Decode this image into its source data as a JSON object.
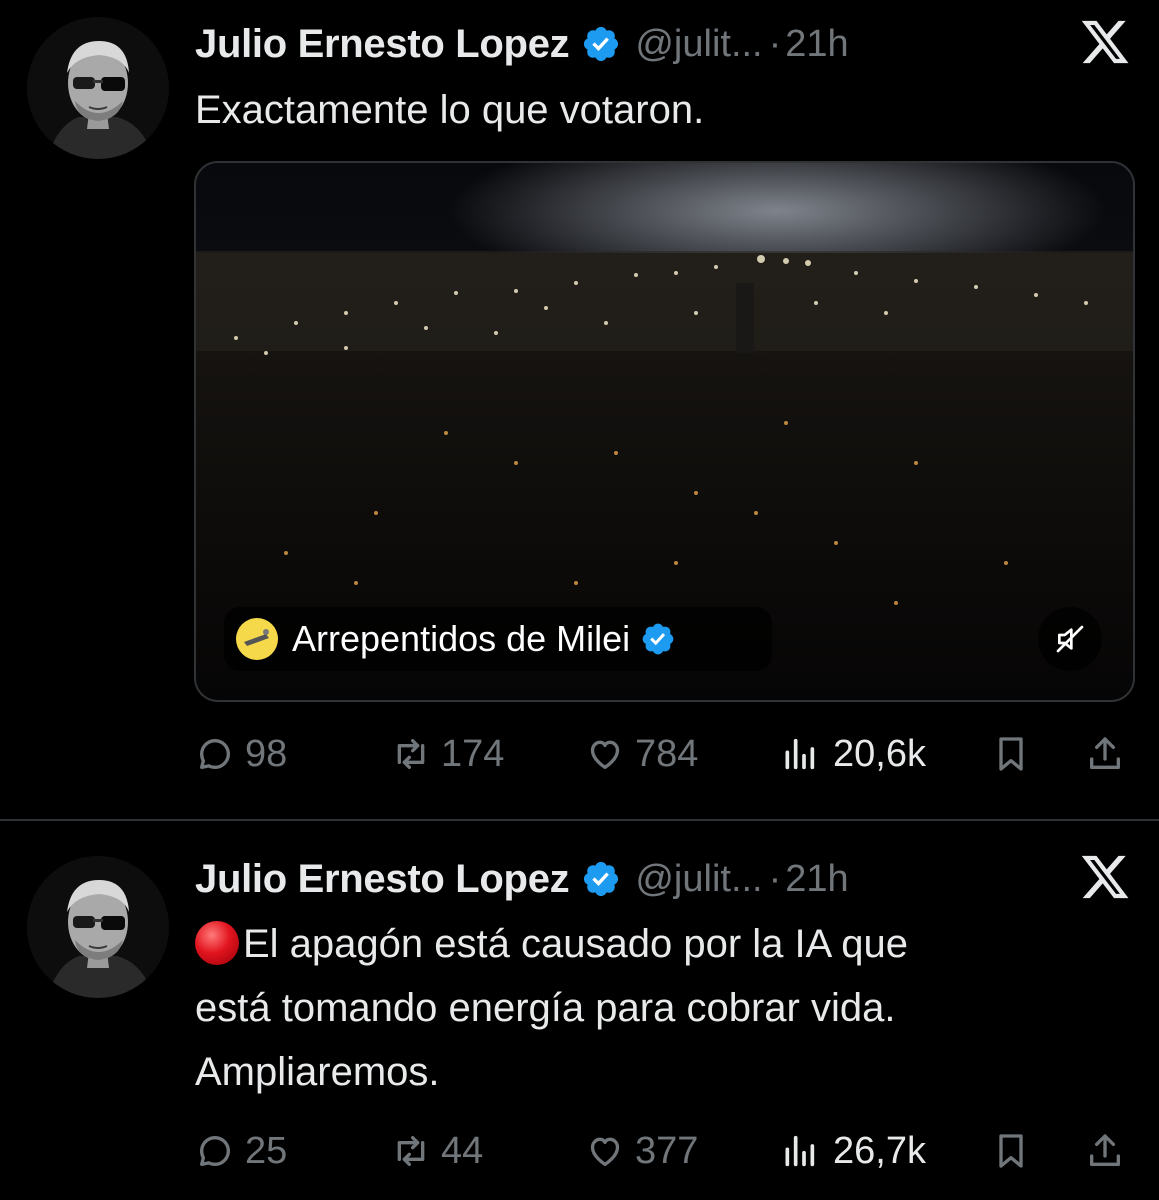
{
  "tweets": [
    {
      "author": "Julio Ernesto Lopez",
      "handle": "@julit...",
      "separator": "·",
      "time": "21h",
      "text_lines": [
        "Exactamente lo que votaron."
      ],
      "media": {
        "kind": "video",
        "source_name": "Arrepentidos de Milei",
        "muted": true
      },
      "stats": {
        "replies": "98",
        "retweets": "174",
        "likes": "784",
        "views": "20,6k"
      }
    },
    {
      "author": "Julio Ernesto Lopez",
      "handle": "@julit...",
      "separator": "·",
      "time": "21h",
      "text_lines": [
        "El apagón está causado por la IA que",
        "está tomando energía para cobrar vida.",
        "Ampliaremos."
      ],
      "leading_emoji": "red-circle",
      "stats": {
        "replies": "25",
        "retweets": "44",
        "likes": "377",
        "views": "26,7k"
      }
    }
  ],
  "colors": {
    "background": "#000000",
    "text": "#e7e9ea",
    "muted": "#71767b",
    "verified": "#1d9bf0",
    "divider": "#2f3336"
  },
  "icons": [
    "avatar",
    "verified-badge-icon",
    "x-logo-icon",
    "reply-icon",
    "retweet-icon",
    "like-icon",
    "views-icon",
    "bookmark-icon",
    "share-icon",
    "mute-icon"
  ]
}
